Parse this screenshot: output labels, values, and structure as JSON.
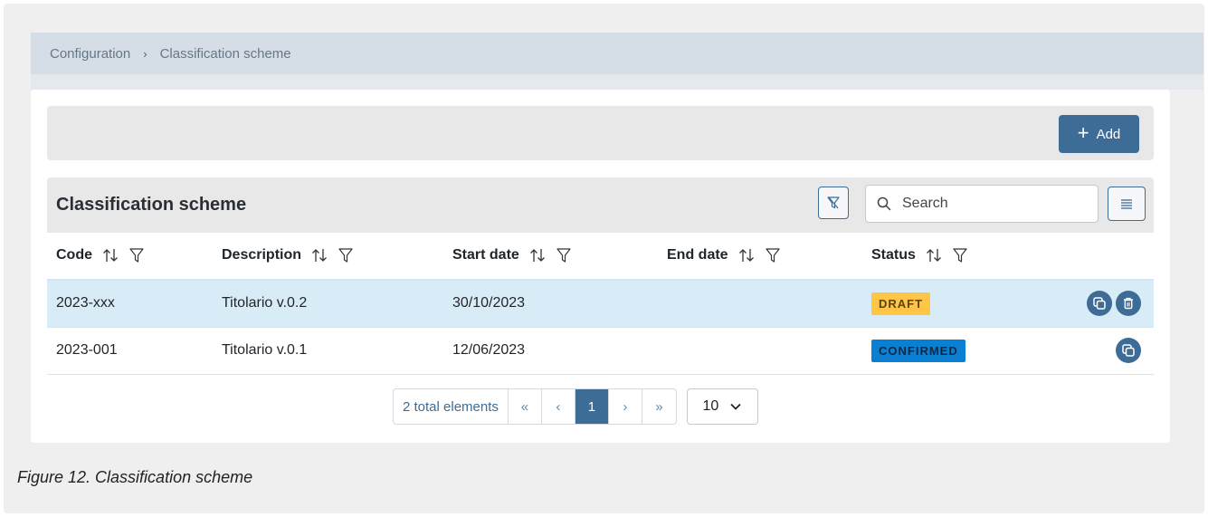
{
  "breadcrumb": {
    "items": [
      "Configuration",
      "Classification scheme"
    ],
    "separator": "›"
  },
  "toolbar": {
    "add_label": "Add",
    "add_icon": "plus-icon"
  },
  "table": {
    "title": "Classification scheme",
    "search_placeholder": "Search",
    "columns": [
      "Code",
      "Description",
      "Start date",
      "End date",
      "Status"
    ],
    "rows": [
      {
        "code": "2023-xxx",
        "description": "Titolario v.0.2",
        "start_date": "30/10/2023",
        "end_date": "",
        "status": "DRAFT",
        "selected": true,
        "actions": [
          "copy",
          "delete"
        ]
      },
      {
        "code": "2023-001",
        "description": "Titolario v.0.1",
        "start_date": "12/06/2023",
        "end_date": "",
        "status": "CONFIRMED",
        "selected": false,
        "actions": [
          "copy"
        ]
      }
    ]
  },
  "pagination": {
    "total_label": "2 total elements",
    "first": "«",
    "prev": "‹",
    "current_page": "1",
    "next": "›",
    "last": "»",
    "page_size": "10"
  },
  "caption": "Figure 12. Classification scheme",
  "colors": {
    "primary": "#3d6c96",
    "selected_row": "#d8ecf7",
    "draft": "#ffc547",
    "confirmed": "#0b7fd1"
  }
}
